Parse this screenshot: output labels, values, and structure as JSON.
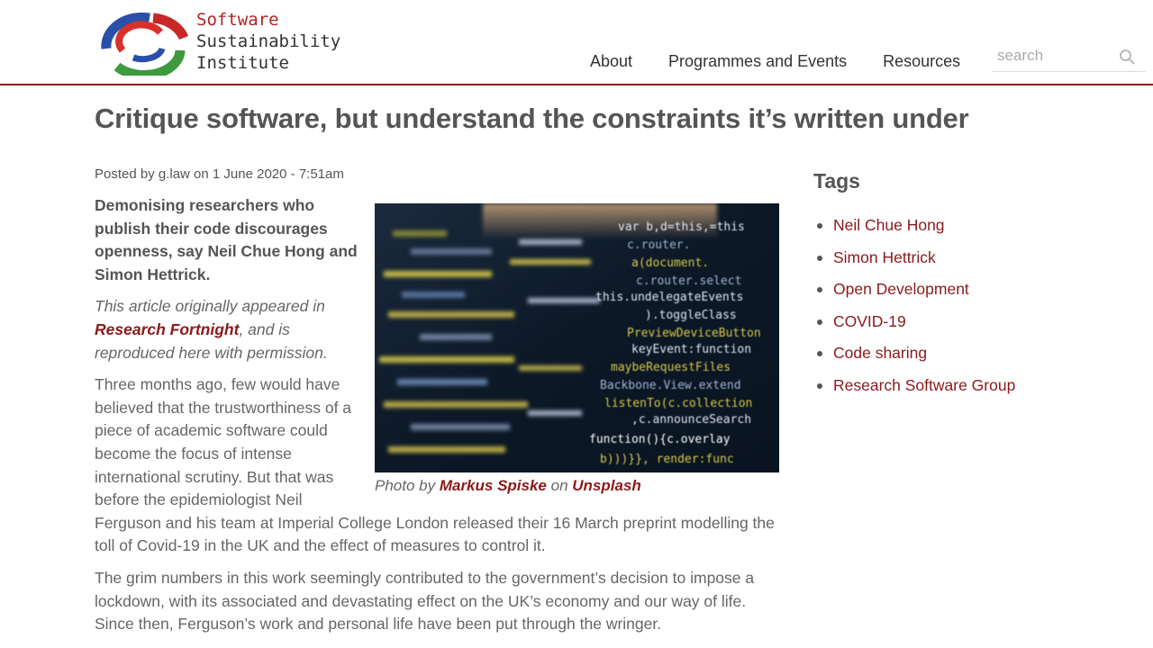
{
  "brand": {
    "line1": "Software",
    "line2": "Sustainability",
    "line3": "Institute"
  },
  "nav": {
    "items": [
      {
        "label": "About"
      },
      {
        "label": "Programmes and Events"
      },
      {
        "label": "Resources"
      }
    ]
  },
  "search": {
    "placeholder": "search",
    "icon": "search-icon"
  },
  "article": {
    "title": "Critique software, but understand the constraints it’s written under",
    "meta": "Posted by g.law on 1 June 2020 - 7:51am",
    "lead": "Demonising researchers who publish their code discourages openness, say Neil Chue Hong and Simon Hettrick.",
    "note_before": "This article originally appeared in ",
    "note_link": "Research Fortnight",
    "note_after": ", and is reproduced here with permission.",
    "paragraph1": "Three months ago, few would have believed that the trustworthiness of a piece of academic software could become the focus of intense international scrutiny. But that was before the epidemiologist Neil Ferguson and his team at Imperial College London released their 16 March preprint modelling the toll of Covid-19 in the UK and the effect of measures to control it.",
    "paragraph2": "The grim numbers in this work seemingly contributed to the government’s decision to impose a lockdown, with its associated and devastating effect on the UK’s economy and our way of life. Since then, Ferguson’s work and personal life have been put through the wringer.",
    "caption_prefix": "Photo by ",
    "caption_author": "Markus Spiske",
    "caption_mid": " on ",
    "caption_source": "Unsplash"
  },
  "sidebar": {
    "heading": "Tags",
    "tags": [
      {
        "label": "Neil Chue Hong"
      },
      {
        "label": "Simon Hettrick"
      },
      {
        "label": "Open Development"
      },
      {
        "label": "COVID-19"
      },
      {
        "label": "Code sharing"
      },
      {
        "label": "Research Software Group"
      }
    ]
  },
  "colors": {
    "accent": "#8b1a1a",
    "text": "#555555"
  }
}
